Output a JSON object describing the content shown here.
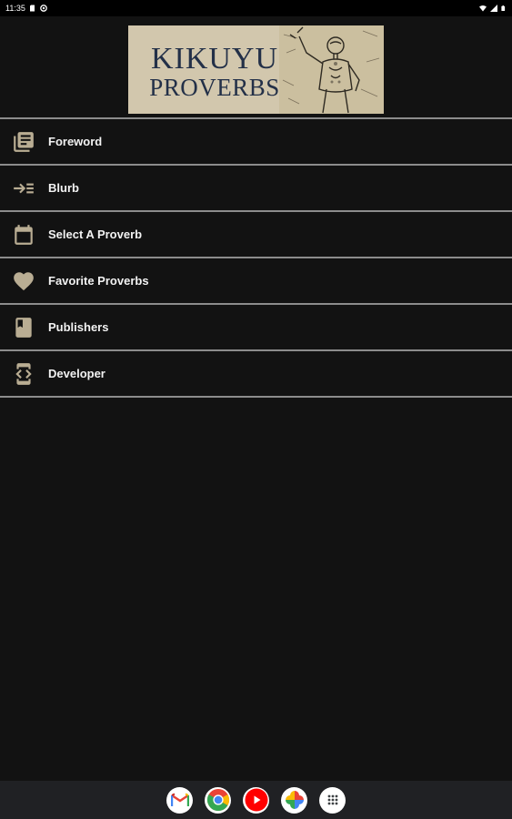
{
  "status_bar": {
    "time": "11:35",
    "icons": [
      "sim-card-icon",
      "settings-dot-icon",
      "wifi-icon",
      "signal-icon",
      "battery-icon"
    ]
  },
  "header": {
    "logo_line1": "KIKUYU",
    "logo_line2": "PROVERBS"
  },
  "menu": {
    "items": [
      {
        "label": "Foreword",
        "icon": "book-stack-icon"
      },
      {
        "label": "Blurb",
        "icon": "indent-arrow-icon"
      },
      {
        "label": "Select A Proverb",
        "icon": "calendar-icon"
      },
      {
        "label": "Favorite Proverbs",
        "icon": "heart-icon"
      },
      {
        "label": "Publishers",
        "icon": "book-icon"
      },
      {
        "label": "Developer",
        "icon": "developer-mode-icon"
      }
    ]
  },
  "dock": {
    "apps": [
      "gmail-icon",
      "chrome-icon",
      "youtube-icon",
      "photos-icon",
      "app-drawer-icon"
    ]
  },
  "colors": {
    "background": "#121212",
    "icon_tint": "#b9ad93",
    "divider": "#8c8c8c",
    "logo_bg": "#d2c7ad",
    "logo_text": "#233048"
  }
}
